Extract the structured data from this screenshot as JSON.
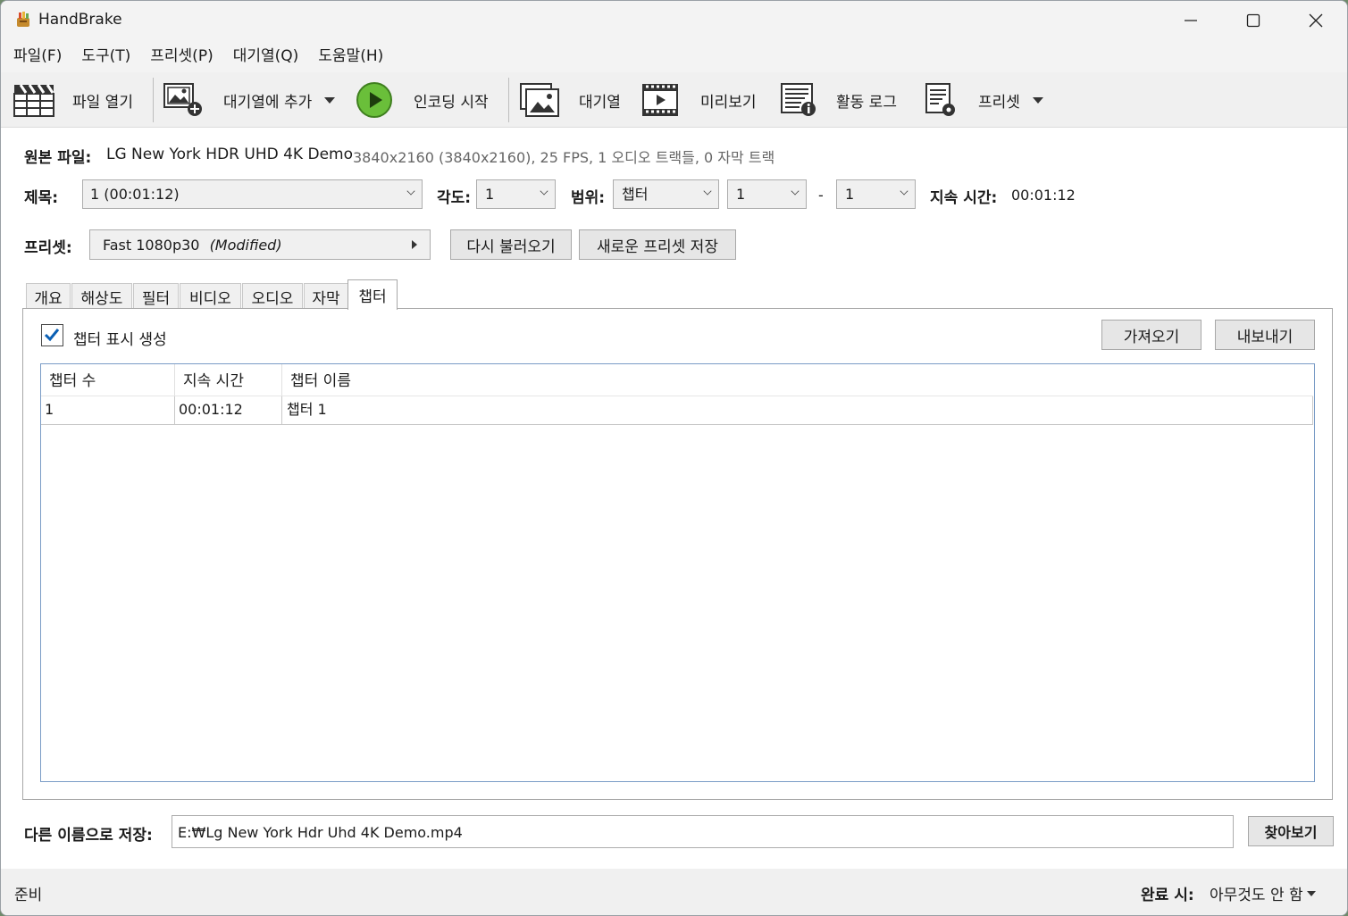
{
  "window": {
    "title": "HandBrake"
  },
  "menu": [
    "파일(F)",
    "도구(T)",
    "프리셋(P)",
    "대기열(Q)",
    "도움말(H)"
  ],
  "toolbar": {
    "open_file": "파일 열기",
    "add_queue": "대기열에 추가",
    "start_encode": "인코딩 시작",
    "queue": "대기열",
    "preview": "미리보기",
    "activity_log": "활동 로그",
    "presets": "프리셋"
  },
  "source": {
    "label": "원본 파일:",
    "name": "LG New York HDR UHD 4K Demo",
    "info": "3840x2160 (3840x2160), 25 FPS, 1 오디오 트랙들, 0 자막 트랙"
  },
  "title_row": {
    "title_label": "제목:",
    "title_value": "1  (00:01:12)",
    "angle_label": "각도:",
    "angle_value": "1",
    "range_label": "범위:",
    "range_type": "챕터",
    "range_start": "1",
    "range_dash": "-",
    "range_end": "1",
    "duration_label": "지속 시간:",
    "duration_value": "00:01:12"
  },
  "preset_row": {
    "label": "프리셋:",
    "name": "Fast 1080p30",
    "modified": "(Modified)",
    "reload": "다시 불러오기",
    "save_new": "새로운 프리셋 저장"
  },
  "tabs": [
    "개요",
    "해상도",
    "필터",
    "비디오",
    "오디오",
    "자막",
    "챕터"
  ],
  "chapters": {
    "create_markers": "챕터 표시 생성",
    "import": "가져오기",
    "export": "내보내기",
    "columns": [
      "챕터 수",
      "지속 시간",
      "챕터 이름"
    ],
    "rows": [
      {
        "number": "1",
        "duration": "00:01:12",
        "name": "챕터 1"
      }
    ]
  },
  "save_as": {
    "label": "다른 이름으로 저장:",
    "path": "E:₩Lg New York Hdr Uhd 4K Demo.mp4",
    "browse": "찾아보기"
  },
  "status": {
    "text": "준비",
    "when_done_label": "완료 시:",
    "when_done_value": "아무것도 안 함"
  }
}
